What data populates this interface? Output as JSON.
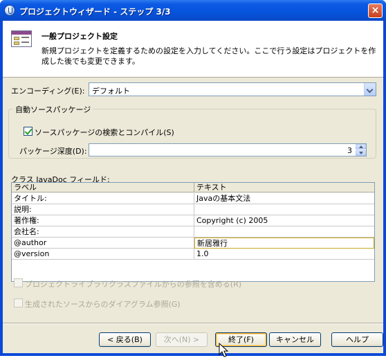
{
  "window": {
    "title": "プロジェクトウィザード - ステップ 3/3",
    "close_label": "×"
  },
  "header": {
    "title": "一般プロジェクト設定",
    "description": "新規プロジェクトを定義するための設定を入力してください。ここで行う設定はプロジェクトを作成した後でも変更できます。",
    "icon": "project-wizard-icon"
  },
  "encoding": {
    "label": "エンコーディング(E):",
    "value": "デフォルト"
  },
  "auto_source": {
    "group_label": "自動ソースパッケージ",
    "checkbox_label": "ソースパッケージの検索とコンパイル(S)",
    "checked": true,
    "depth_label": "パッケージ深度(D):",
    "depth_value": "3"
  },
  "javadoc": {
    "label": "クラス JavaDoc フィールド:",
    "columns": [
      "ラベル",
      "テキスト"
    ],
    "rows": [
      {
        "label": "タイトル:",
        "text": "Javaの基本文法"
      },
      {
        "label": "説明:",
        "text": ""
      },
      {
        "label": "著作権:",
        "text": "Copyright (c) 2005"
      },
      {
        "label": "会社名:",
        "text": ""
      },
      {
        "label": "@author",
        "text": "新居雅行"
      },
      {
        "label": "@version",
        "text": "1.0"
      }
    ]
  },
  "options": {
    "include_library_refs": "プロジェクトライブラリクラスファイルからの参照を含める(R)",
    "diagram_refs": "生成されたソースからのダイアグラム参照(G)"
  },
  "buttons": {
    "back": "< 戻る(B)",
    "next": "次へ(N) >",
    "finish": "終了(F)",
    "cancel": "キャンセル",
    "help": "ヘルプ"
  }
}
